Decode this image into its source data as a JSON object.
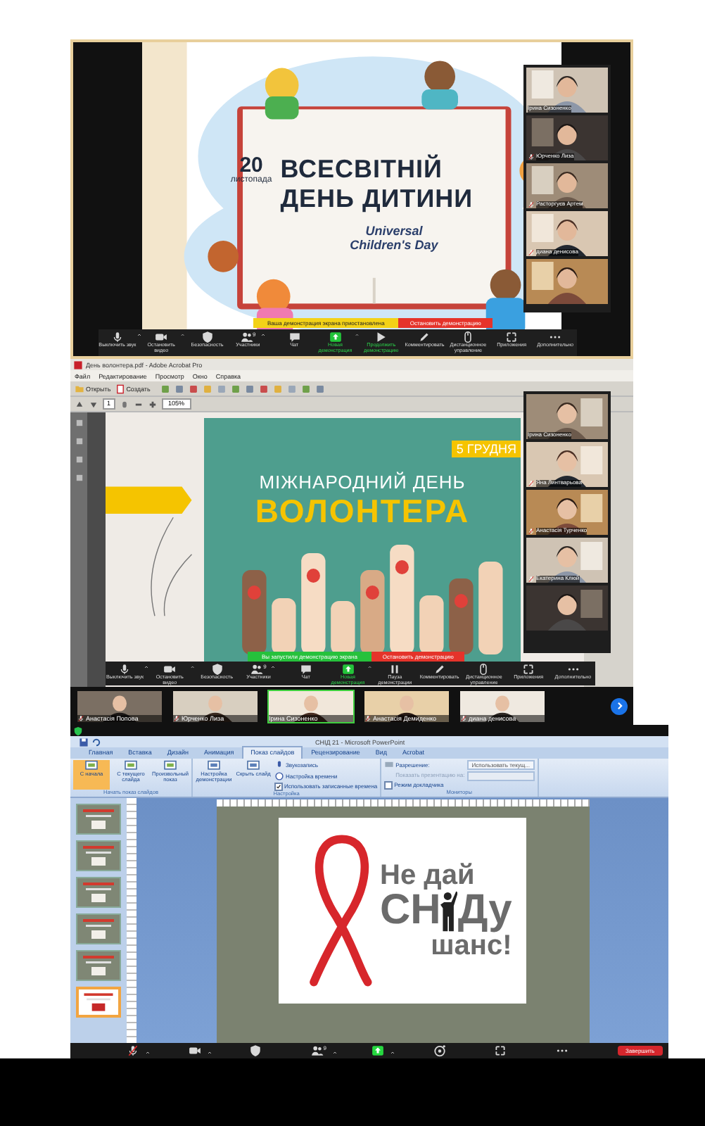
{
  "meeting_1": {
    "slide": {
      "date_day": "20",
      "date_month": "листопада",
      "title": [
        "ВСЕСВІТНІЙ",
        "ДЕНЬ ДИТИНИ"
      ],
      "subtitle": [
        "Universal",
        "Children's Day"
      ]
    },
    "video_panel": [
      {
        "name": "Ірина Сизоненко",
        "muted": false
      },
      {
        "name": "Юрченко Лиза",
        "muted": true
      },
      {
        "name": "Расторгуєв Артем",
        "muted": true
      },
      {
        "name": "диана денисова",
        "muted": true
      },
      {
        "muted": false
      }
    ],
    "share_banner": {
      "status": "Ваша демонстрация экрана приостановлена",
      "stop": "Остановить демонстрацию"
    },
    "toolbar": [
      {
        "kind": "mic",
        "label": "Выключить звук",
        "menu": true,
        "highlighted": false
      },
      {
        "kind": "video",
        "label": "Остановить видео",
        "menu": true,
        "highlighted": false
      },
      {
        "kind": "shield",
        "label": "Безопасность",
        "menu": false,
        "highlighted": false
      },
      {
        "kind": "people",
        "label": "Участники",
        "count": "9",
        "menu": true,
        "highlighted": false
      },
      {
        "kind": "chat",
        "label": "Чат",
        "menu": false,
        "highlighted": false
      },
      {
        "kind": "share",
        "label": "Новая демонстрация",
        "menu": true,
        "highlighted": true
      },
      {
        "kind": "play",
        "label": "Продолжить демонстрацию",
        "menu": false,
        "highlighted": true
      },
      {
        "kind": "pen",
        "label": "Комментировать",
        "menu": false,
        "highlighted": false
      },
      {
        "kind": "remote",
        "label": "Дистанционное управление",
        "menu": false,
        "highlighted": false
      },
      {
        "kind": "apps",
        "label": "Приложения",
        "menu": false,
        "highlighted": false
      },
      {
        "kind": "more",
        "label": "Дополнительно",
        "menu": false,
        "highlighted": false
      }
    ]
  },
  "meeting_2": {
    "window": {
      "title": "День волонтера.pdf - Adobe Acrobat Pro"
    },
    "menu": [
      "Файл",
      "Редактирование",
      "Просмотр",
      "Окно",
      "Справка"
    ],
    "toolbar": {
      "open": "Открыть",
      "create": "Создать",
      "page": "1",
      "zoom": "105%"
    },
    "slide": {
      "date": "5 ГРУДНЯ",
      "title": "МІЖНАРОДНИЙ ДЕНЬ",
      "highlight": "ВОЛОНТЕРА"
    },
    "video_panel": [
      {
        "name": "Ірина Сизоненко",
        "muted": false
      },
      {
        "name": "Яна Линтварьова",
        "muted": true
      },
      {
        "name": "Анастасія Турченко",
        "muted": true
      },
      {
        "name": "Екатерина Клюй",
        "muted": true
      },
      {
        "muted": false
      }
    ],
    "share_banner": {
      "status": "Вы запустили демонстрацию экрана",
      "stop": "Остановить демонстрацию"
    },
    "meeting_toolbar": [
      {
        "kind": "mic",
        "label": "Выключить звук",
        "menu": true,
        "highlighted": false
      },
      {
        "kind": "video",
        "label": "Остановить видео",
        "menu": true,
        "highlighted": false
      },
      {
        "kind": "shield",
        "label": "Безопасность",
        "menu": false,
        "highlighted": false
      },
      {
        "kind": "people",
        "label": "Участники",
        "count": "9",
        "menu": true,
        "highlighted": false
      },
      {
        "kind": "chat",
        "label": "Чат",
        "menu": false,
        "highlighted": false
      },
      {
        "kind": "share",
        "label": "Новая демонстрация",
        "menu": true,
        "highlighted": true
      },
      {
        "kind": "pause",
        "label": "Пауза демонстрации",
        "menu": false,
        "highlighted": false
      },
      {
        "kind": "pen",
        "label": "Комментировать",
        "menu": false,
        "highlighted": false
      },
      {
        "kind": "remote",
        "label": "Дистанционное управление",
        "menu": false,
        "highlighted": false
      },
      {
        "kind": "apps",
        "label": "Приложения",
        "menu": false,
        "highlighted": false
      },
      {
        "kind": "more",
        "label": "Дополнительно",
        "menu": false,
        "highlighted": false
      }
    ],
    "gallery": [
      {
        "name": "Анастасія Попова",
        "muted": true,
        "speaking": false
      },
      {
        "name": "Юрченко Лиза",
        "muted": true,
        "speaking": false
      },
      {
        "name": "Ірина Сизоненко",
        "muted": false,
        "speaking": true
      },
      {
        "name": "Анастасія Демиденко",
        "muted": true,
        "speaking": false
      },
      {
        "name": "диана денисова",
        "muted": true,
        "speaking": false
      }
    ]
  },
  "meeting_3": {
    "window": {
      "title": "СНІД 21 - Microsoft PowerPoint"
    },
    "tabs": [
      {
        "label": "Главная",
        "selected": false
      },
      {
        "label": "Вставка",
        "selected": false
      },
      {
        "label": "Дизайн",
        "selected": false
      },
      {
        "label": "Анимация",
        "selected": false
      },
      {
        "label": "Показ слайдов",
        "selected": true
      },
      {
        "label": "Рецензирование",
        "selected": false
      },
      {
        "label": "Вид",
        "selected": false
      },
      {
        "label": "Acrobat",
        "selected": false
      }
    ],
    "ribbon": {
      "start_group": {
        "title": "Начать показ слайдов",
        "buttons": [
          {
            "label": "С начала",
            "selected": true
          },
          {
            "label": "С текущего слайда",
            "selected": false
          },
          {
            "label": "Произвольный показ",
            "selected": false
          }
        ]
      },
      "setup_group": {
        "title": "Настройка",
        "buttons": [
          "Настройка демонстрации",
          "Скрыть слайд"
        ],
        "record": "Звукозапись",
        "timing": "Настройка времени",
        "use_timings": {
          "label": "Использовать записанные времена",
          "checked": true
        }
      },
      "monitors_group": {
        "title": "Мониторы",
        "resolution_label": "Разрешение:",
        "resolution_value": "Использовать текущ...",
        "show_on_label": "Показать презентацию на:",
        "presenter_view": {
          "label": "Режим докладчика",
          "checked": false
        }
      }
    },
    "slide_thumbnails": [
      {
        "selected": false
      },
      {
        "selected": false
      },
      {
        "selected": false
      },
      {
        "selected": false
      },
      {
        "selected": false
      },
      {
        "selected": true
      }
    ],
    "slide": {
      "line_1": "Не дай",
      "line_2_start": "СН",
      "line_2_end": "Ду",
      "line_3": "шанс!"
    },
    "meeting_toolbar": [
      {
        "kind": "mic-off",
        "menu": true,
        "highlighted": false
      },
      {
        "kind": "video",
        "menu": true,
        "highlighted": false
      },
      {
        "kind": "shield",
        "menu": false,
        "highlighted": false
      },
      {
        "kind": "people",
        "count": "9",
        "menu": true,
        "highlighted": false
      },
      {
        "kind": "share",
        "menu": true,
        "highlighted": true
      },
      {
        "kind": "dial",
        "menu": false,
        "highlighted": false
      },
      {
        "kind": "apps",
        "menu": false,
        "highlighted": false
      },
      {
        "kind": "more",
        "menu": false,
        "highlighted": false
      }
    ],
    "end_button": "Завершить"
  }
}
